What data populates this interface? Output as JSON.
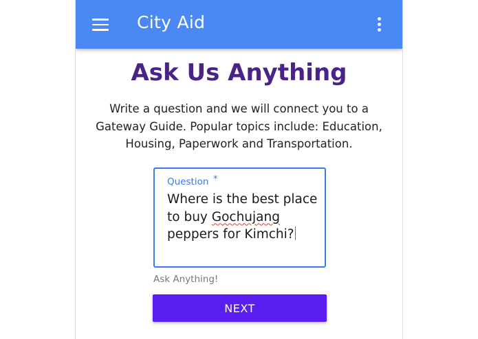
{
  "app_bar": {
    "title": "City Aid",
    "background_color": "#4a89f3",
    "left_icon": "menu-icon",
    "right_icon": "more-vertical-icon"
  },
  "main": {
    "heading": "Ask Us Anything",
    "heading_color": "#4a2386",
    "intro": "Write a question and we will connect you to a Gateway Guide. Popular topics include: Education, Housing, Paperwork and Transportation."
  },
  "question_field": {
    "label": "Question",
    "required_mark": "*",
    "value_part1": "Where is the best place to buy ",
    "value_misspelled": "Gochujang",
    "value_part2": " peppers for Kimchi?",
    "helper_text": "Ask Anything!",
    "focus_color": "#3b78e7"
  },
  "actions": {
    "next_label": "NEXT",
    "next_color": "#5a1ff0"
  }
}
